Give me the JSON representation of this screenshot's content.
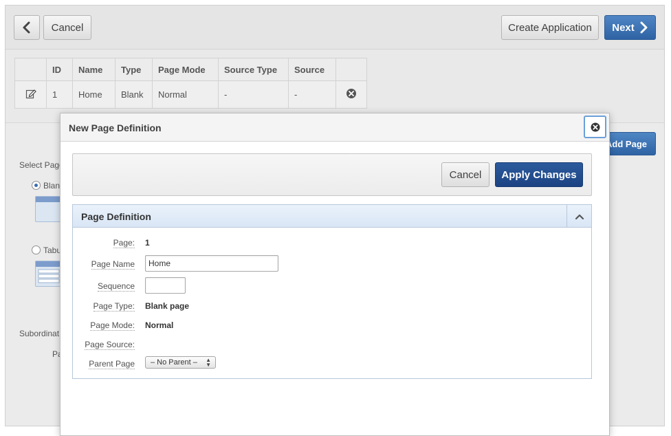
{
  "topbar": {
    "back_icon": "chevron-left-icon",
    "cancel_label": "Cancel",
    "create_label": "Create Application",
    "next_label": "Next",
    "next_icon": "chevron-right-icon"
  },
  "pages_table": {
    "columns": [
      "",
      "ID",
      "Name",
      "Type",
      "Page Mode",
      "Source Type",
      "Source",
      ""
    ],
    "rows": [
      {
        "edit_icon": "edit-icon",
        "id": "1",
        "name": "Home",
        "type": "Blank",
        "mode": "Normal",
        "source_type": "-",
        "source": "-",
        "delete_icon": "remove-icon"
      }
    ]
  },
  "background": {
    "add_page_label": "Add Page",
    "select_page_label": "Select Page",
    "blank_option": "Blank",
    "tabular_option": "Tabu",
    "subordinate_label": "Subordinat",
    "pa_label": "Pa"
  },
  "dialog": {
    "title": "New Page Definition",
    "close_icon": "close-icon",
    "cancel_label": "Cancel",
    "apply_label": "Apply Changes",
    "region_title": "Page Definition",
    "collapse_icon": "chevron-up-icon",
    "fields": {
      "page_label": "Page:",
      "page_value": "1",
      "page_name_label": "Page Name",
      "page_name_value": "Home",
      "sequence_label": "Sequence",
      "sequence_value": "",
      "page_type_label": "Page Type:",
      "page_type_value": "Blank page",
      "page_mode_label": "Page Mode:",
      "page_mode_value": "Normal",
      "page_source_label": "Page Source:",
      "parent_page_label": "Parent Page",
      "parent_page_value": "– No Parent –"
    }
  }
}
